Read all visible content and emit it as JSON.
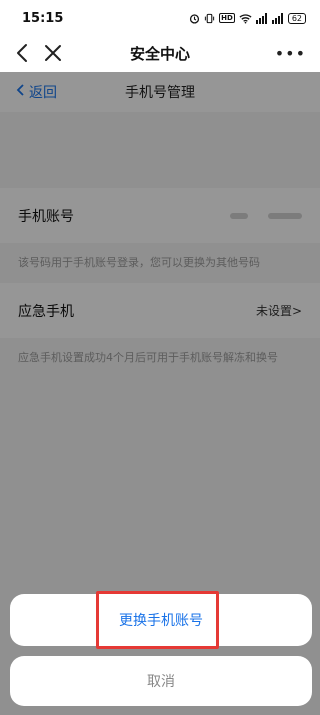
{
  "status_bar": {
    "time": "15:15",
    "icons": [
      "alarm-icon",
      "vibrate-icon",
      "hd-icon",
      "wifi-icon",
      "signal-icon",
      "signal-icon"
    ],
    "hd_label": "HD",
    "battery": "62"
  },
  "nav": {
    "title": "安全中心"
  },
  "page": {
    "back_label": "返回",
    "title": "手机号管理",
    "phone_row_label": "手机账号",
    "phone_hint": "该号码用于手机账号登录，您可以更换为其他号码",
    "emergency_row_label": "应急手机",
    "emergency_row_value": "未设置>",
    "emergency_hint": "应急手机设置成功4个月后可用于手机账号解冻和换号"
  },
  "sheet": {
    "change_label": "更换手机账号",
    "cancel_label": "取消"
  },
  "colors": {
    "accent": "#1a73e8",
    "highlight": "#e53935"
  }
}
